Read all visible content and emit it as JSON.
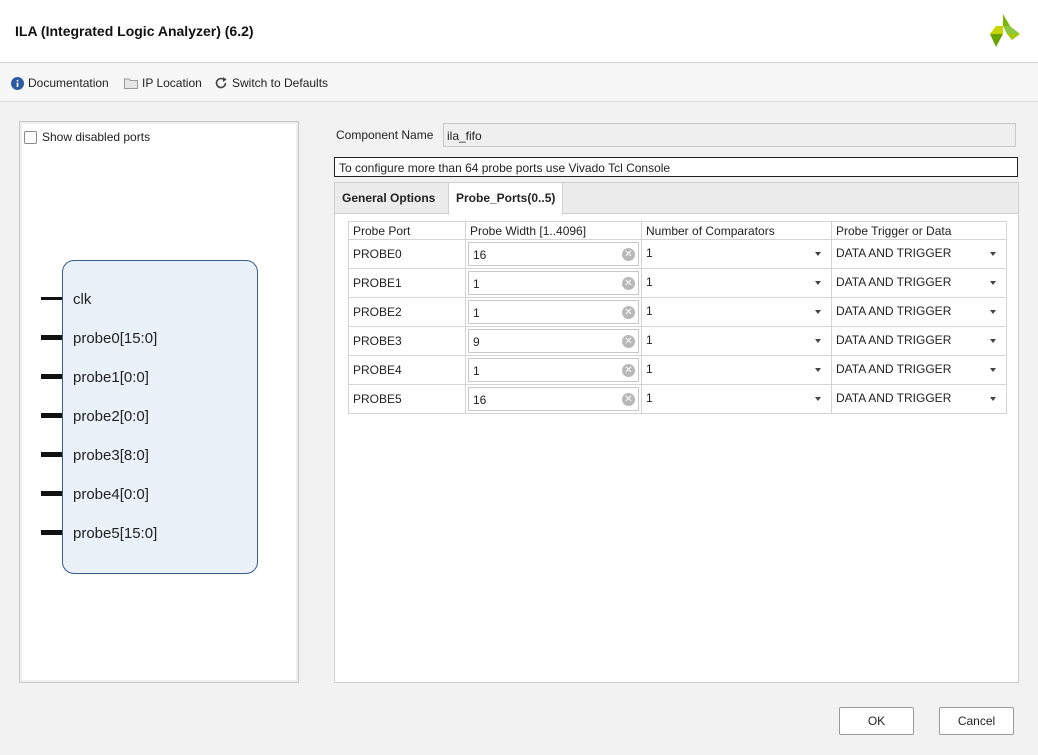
{
  "window": {
    "title": "ILA (Integrated Logic Analyzer) (6.2)"
  },
  "toolbar": {
    "documentation_label": "Documentation",
    "ip_location_label": "IP Location",
    "switch_defaults_label": "Switch to Defaults"
  },
  "left_panel": {
    "show_disabled_ports_label": "Show disabled ports",
    "show_disabled_ports_checked": false,
    "pins": [
      "clk",
      "probe0[15:0]",
      "probe1[0:0]",
      "probe2[0:0]",
      "probe3[8:0]",
      "probe4[0:0]",
      "probe5[15:0]"
    ]
  },
  "component": {
    "label": "Component Name",
    "value": "ila_fifo"
  },
  "notice": "To configure more than 64 probe ports use Vivado Tcl Console",
  "tabs": [
    {
      "label": "General Options",
      "active": false
    },
    {
      "label": "Probe_Ports(0..5)",
      "active": true
    }
  ],
  "table": {
    "headers": [
      "Probe Port",
      "Probe Width [1..4096]",
      "Number of Comparators",
      "Probe Trigger or Data"
    ],
    "rows": [
      {
        "port": "PROBE0",
        "width": "16",
        "comparators": "1",
        "trigger": "DATA AND TRIGGER"
      },
      {
        "port": "PROBE1",
        "width": "1",
        "comparators": "1",
        "trigger": "DATA AND TRIGGER"
      },
      {
        "port": "PROBE2",
        "width": "1",
        "comparators": "1",
        "trigger": "DATA AND TRIGGER"
      },
      {
        "port": "PROBE3",
        "width": "9",
        "comparators": "1",
        "trigger": "DATA AND TRIGGER"
      },
      {
        "port": "PROBE4",
        "width": "1",
        "comparators": "1",
        "trigger": "DATA AND TRIGGER"
      },
      {
        "port": "PROBE5",
        "width": "16",
        "comparators": "1",
        "trigger": "DATA AND TRIGGER"
      }
    ]
  },
  "buttons": {
    "ok": "OK",
    "cancel": "Cancel"
  },
  "colors": {
    "accent": "#7ab800",
    "block_fill": "#eaf1f9",
    "block_border": "#3a5a8a"
  }
}
